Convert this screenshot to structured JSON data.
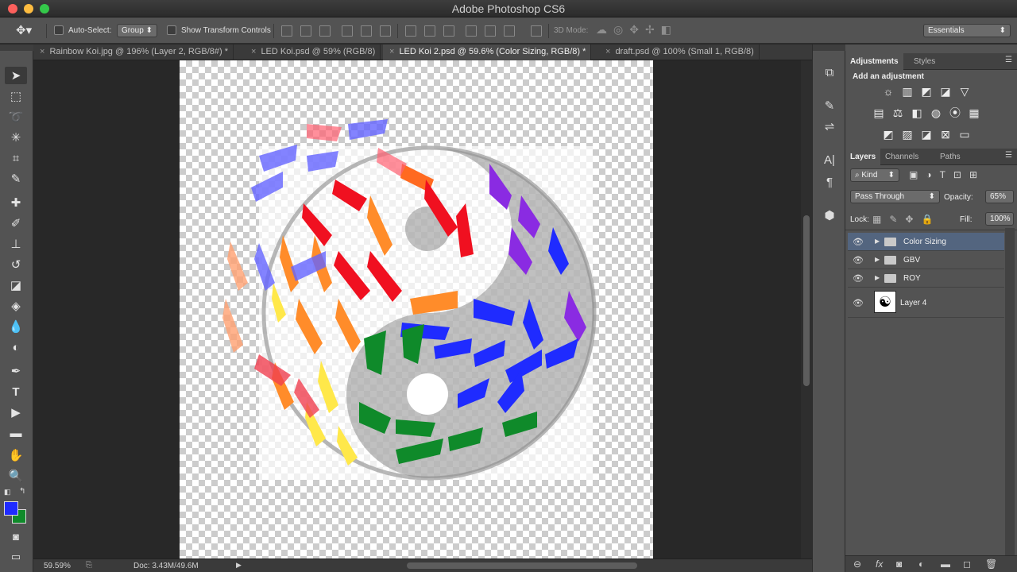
{
  "app": {
    "title": "Adobe Photoshop CS6"
  },
  "options": {
    "auto_select_label": "Auto-Select:",
    "auto_select_value": "Group",
    "show_transform_label": "Show Transform Controls",
    "mode3d_label": "3D Mode:",
    "workspace_value": "Essentials"
  },
  "tabs": [
    {
      "label": "Rainbow Koi.jpg @ 196% (Layer 2, RGB/8#) *",
      "active": false
    },
    {
      "label": "LED Koi.psd @ 59% (RGB/8)",
      "active": false
    },
    {
      "label": "LED Koi 2.psd @ 59.6% (Color Sizing, RGB/8) *",
      "active": true
    },
    {
      "label": "draft.psd @ 100% (Small 1, RGB/8)",
      "active": false
    }
  ],
  "status": {
    "zoom": "59.59%",
    "doc": "Doc: 3.43M/49.6M"
  },
  "colors": {
    "foreground": "#1f2bff",
    "background": "#0f8a2a",
    "selection": "#53657f"
  },
  "adjustments": {
    "tabs": [
      "Adjustments",
      "Styles"
    ],
    "heading": "Add an adjustment"
  },
  "layers_panel": {
    "tabs": [
      "Layers",
      "Channels",
      "Paths"
    ],
    "filter_kind": "Kind",
    "blend_mode": "Pass Through",
    "opacity_label": "Opacity:",
    "opacity_value": "65%",
    "lock_label": "Lock:",
    "fill_label": "Fill:",
    "fill_value": "100%",
    "layers": [
      {
        "name": "Color Sizing",
        "type": "group",
        "selected": true
      },
      {
        "name": "GBV",
        "type": "group",
        "selected": false
      },
      {
        "name": "ROY",
        "type": "group",
        "selected": false
      },
      {
        "name": "Layer 4",
        "type": "layer",
        "selected": false
      }
    ]
  }
}
